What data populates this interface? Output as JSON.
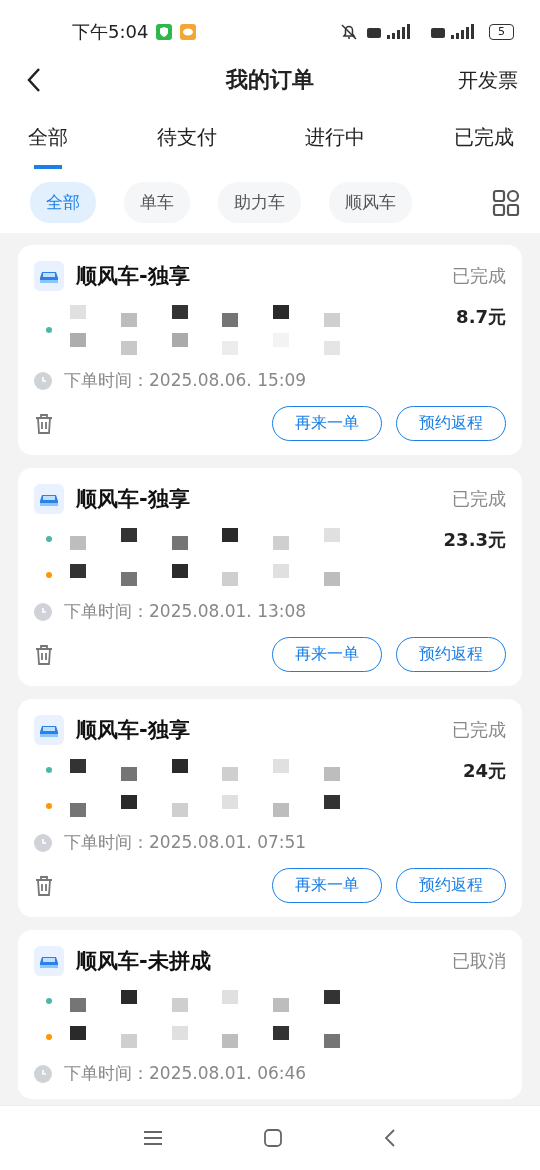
{
  "status_bar": {
    "time": "下午5:04",
    "battery": "5"
  },
  "header": {
    "title": "我的订单",
    "action": "开发票"
  },
  "tabs": [
    {
      "label": "全部",
      "selected": true
    },
    {
      "label": "待支付",
      "selected": false
    },
    {
      "label": "进行中",
      "selected": false
    },
    {
      "label": "已完成",
      "selected": false
    }
  ],
  "filters": [
    {
      "label": "全部",
      "selected": true
    },
    {
      "label": "单车",
      "selected": false
    },
    {
      "label": "助力车",
      "selected": false
    },
    {
      "label": "顺风车",
      "selected": false
    }
  ],
  "orders": [
    {
      "title": "顺风车-独享",
      "status": "已完成",
      "price": "8.7元",
      "stops": [
        {
          "color": "#4db6ac"
        }
      ],
      "time": "下单时间：2025.08.06. 15:09",
      "buttons": [
        "再来一单",
        "预约返程"
      ]
    },
    {
      "title": "顺风车-独享",
      "status": "已完成",
      "price": "23.3元",
      "stops": [
        {
          "color": "#4db6ac"
        },
        {
          "color": "#ff9800"
        }
      ],
      "time": "下单时间：2025.08.01. 13:08",
      "buttons": [
        "再来一单",
        "预约返程"
      ]
    },
    {
      "title": "顺风车-独享",
      "status": "已完成",
      "price": "24元",
      "stops": [
        {
          "color": "#4db6ac"
        },
        {
          "color": "#ff9800"
        }
      ],
      "time": "下单时间：2025.08.01. 07:51",
      "buttons": [
        "再来一单",
        "预约返程"
      ]
    },
    {
      "title": "顺风车-未拼成",
      "status": "已取消",
      "stops": [
        {
          "color": "#4db6ac"
        },
        {
          "color": "#ff9800"
        }
      ],
      "time": "下单时间：2025.08.01. 06:46"
    }
  ]
}
